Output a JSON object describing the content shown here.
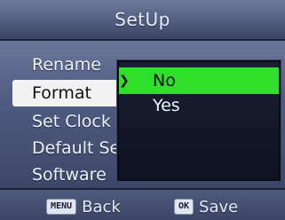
{
  "title": "SetUp",
  "menu": {
    "items": [
      {
        "label": "Rename"
      },
      {
        "label": "Format"
      },
      {
        "label": "Set Clock"
      },
      {
        "label": "Default Se"
      },
      {
        "label": "Software"
      }
    ],
    "selected_index": 1
  },
  "submenu": {
    "items": [
      {
        "label": "No"
      },
      {
        "label": "Yes"
      }
    ],
    "selected_index": 0,
    "arrow": "❯"
  },
  "footer": {
    "back_key": "MENU",
    "back_label": "Back",
    "save_key": "OK",
    "save_label": "Save"
  },
  "colors": {
    "highlight_green": "#2fe02a",
    "selected_bg": "#f2f2f2"
  }
}
